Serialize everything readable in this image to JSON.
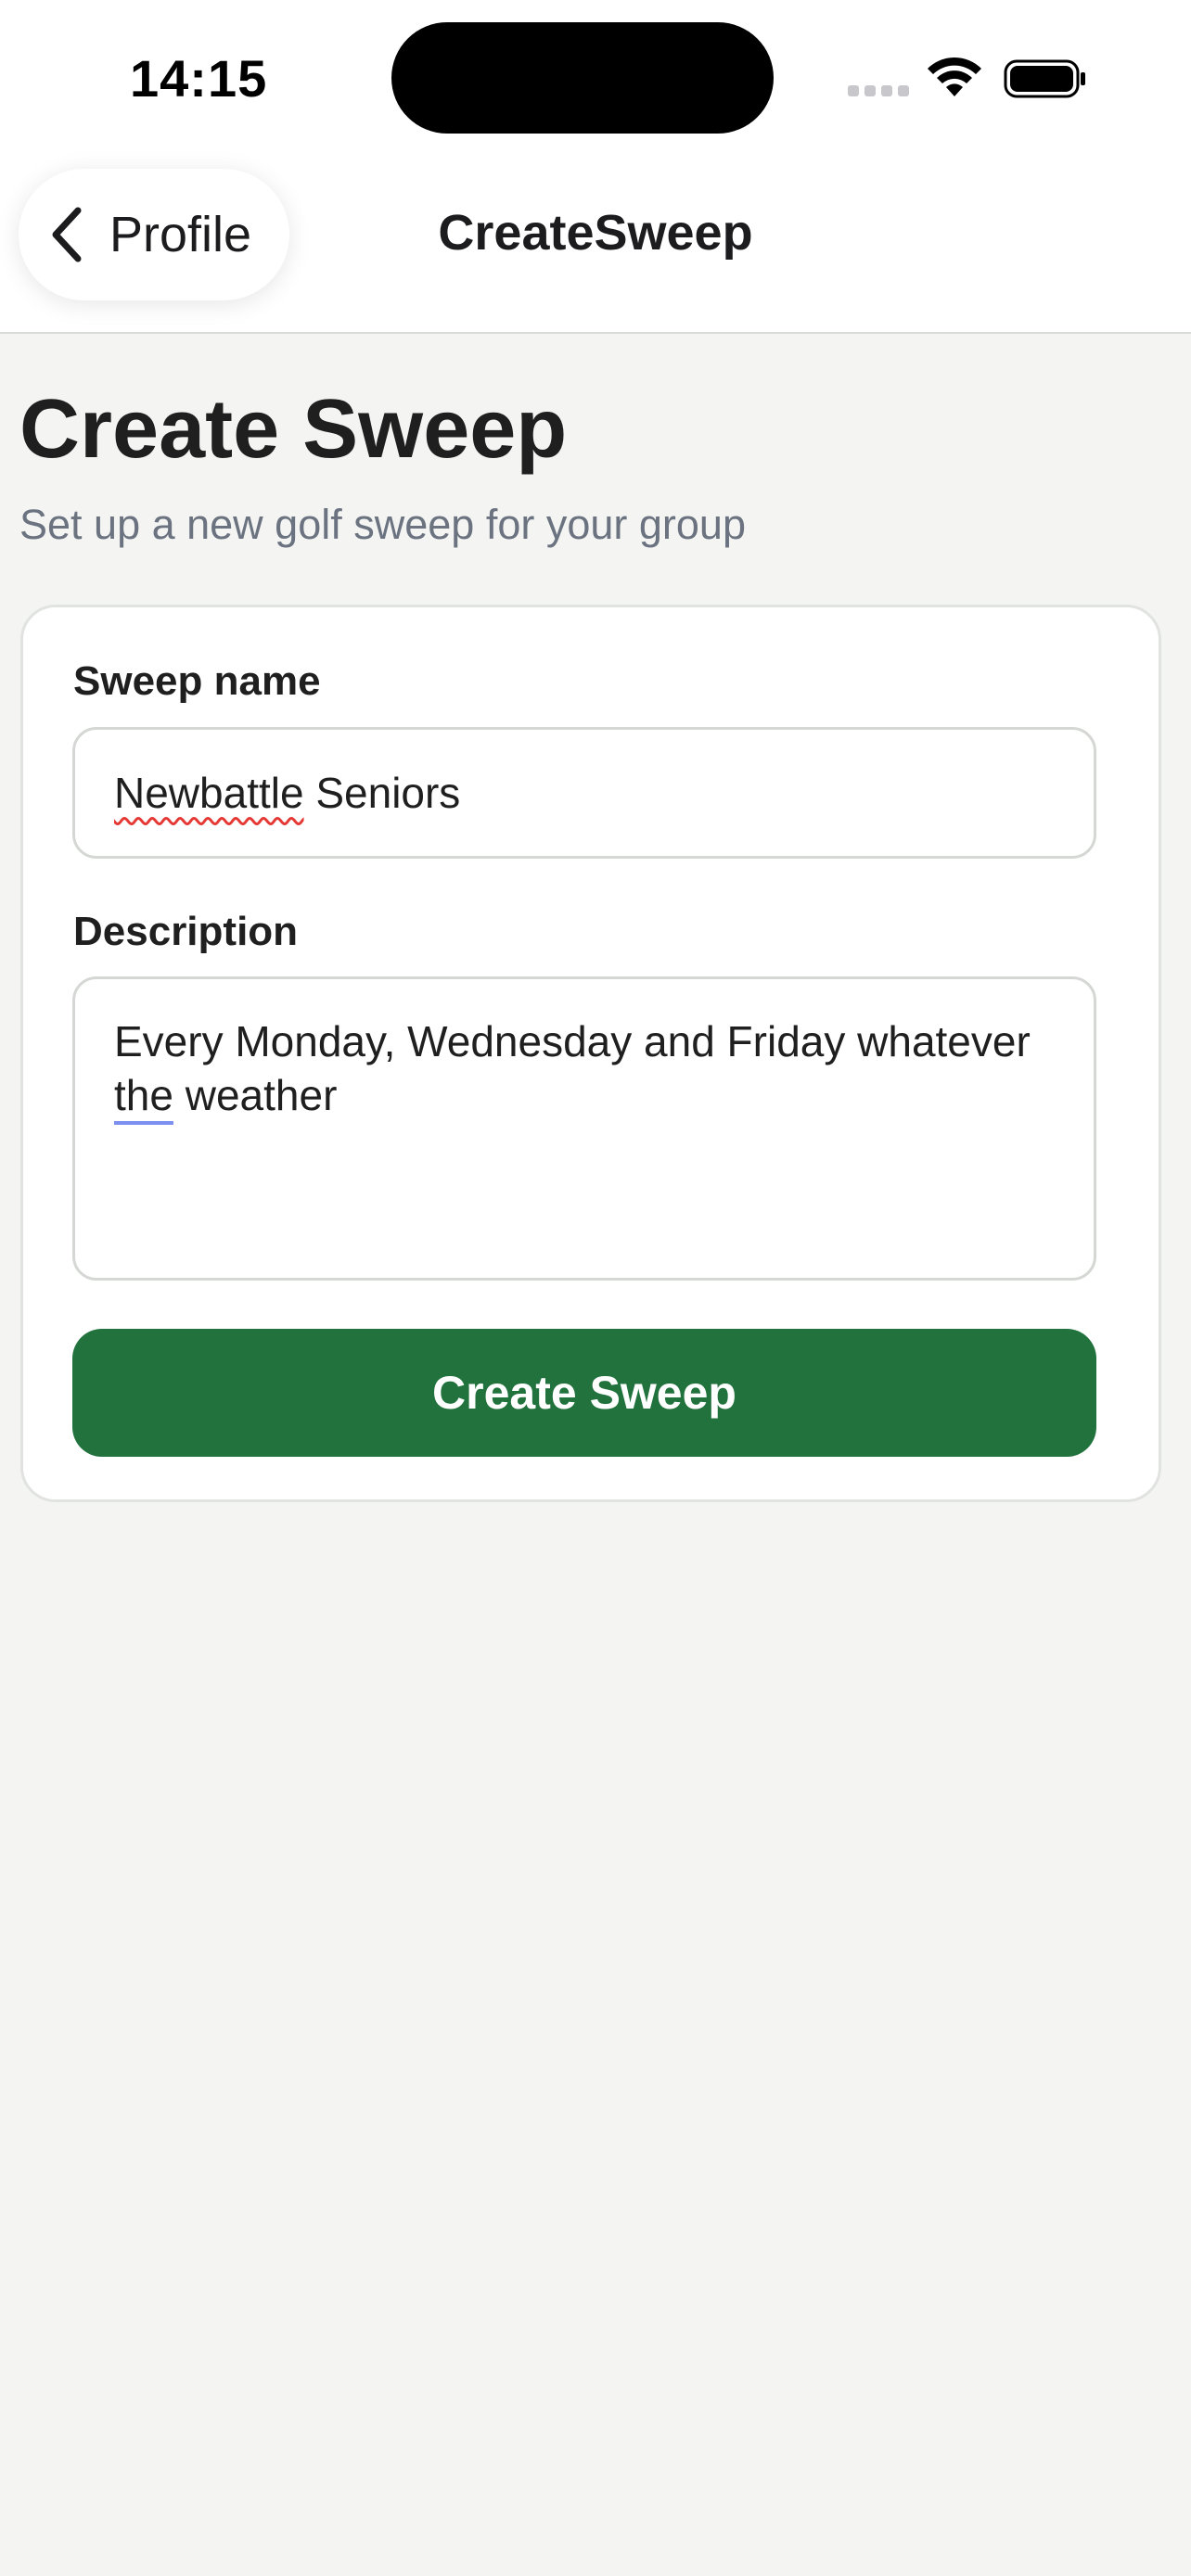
{
  "status_bar": {
    "time": "14:15"
  },
  "nav": {
    "back_label": "Profile",
    "title": "CreateSweep"
  },
  "page": {
    "title": "Create Sweep",
    "subtitle": "Set up a new golf sweep for your group"
  },
  "form": {
    "name_label": "Sweep name",
    "name_value": {
      "misspelled": "Newbattle",
      "rest": " Seniors"
    },
    "description_label": "Description",
    "description_value": {
      "line1": "Every Monday, Wednesday and Friday whatever",
      "flagged": "the",
      "rest": " weather"
    },
    "submit_label": "Create Sweep"
  },
  "colors": {
    "primary": "#21723d",
    "background": "#f4f5f3",
    "subtitle": "#6b7380"
  },
  "icons": [
    "signal-icon",
    "wifi-icon",
    "battery-icon",
    "chevron-left-icon"
  ]
}
